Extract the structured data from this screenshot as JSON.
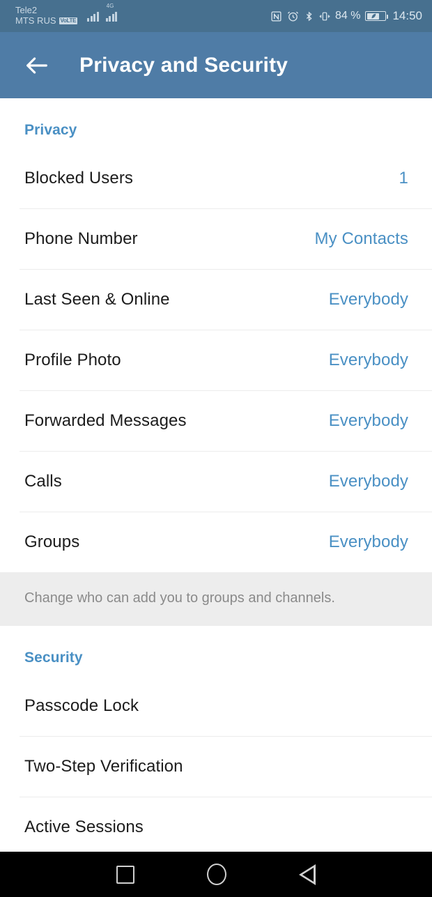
{
  "status_bar": {
    "carrier_line1": "Tele2",
    "carrier_line2": "MTS RUS",
    "volte_badge": "VoLTE",
    "network_type": "4G",
    "battery_percent": "84 %",
    "clock": "14:50",
    "icons": [
      "nfc-icon",
      "alarm-icon",
      "bluetooth-icon",
      "vibrate-icon",
      "battery-saver-icon"
    ],
    "background_color": "#47708F"
  },
  "app_bar": {
    "title": "Privacy and Security",
    "back_icon": "back-arrow-icon",
    "background_color": "#4F7CA6"
  },
  "privacy_section": {
    "heading": "Privacy",
    "rows": [
      {
        "label": "Blocked Users",
        "value": "1"
      },
      {
        "label": "Phone Number",
        "value": "My Contacts"
      },
      {
        "label": "Last Seen & Online",
        "value": "Everybody"
      },
      {
        "label": "Profile Photo",
        "value": "Everybody"
      },
      {
        "label": "Forwarded Messages",
        "value": "Everybody"
      },
      {
        "label": "Calls",
        "value": "Everybody"
      },
      {
        "label": "Groups",
        "value": "Everybody"
      }
    ],
    "footer_note": "Change who can add you to groups and channels."
  },
  "security_section": {
    "heading": "Security",
    "rows": [
      {
        "label": "Passcode Lock",
        "value": ""
      },
      {
        "label": "Two-Step Verification",
        "value": ""
      },
      {
        "label": "Active Sessions",
        "value": ""
      }
    ]
  },
  "nav_bar": {
    "recents_icon": "square-recents-icon",
    "home_icon": "circle-home-icon",
    "back_icon": "triangle-back-icon"
  },
  "colors": {
    "accent": "#4A90C4",
    "header": "#4F7CA6",
    "status": "#47708F",
    "note_bg": "#EDEDED",
    "divider": "#ECECEC"
  }
}
